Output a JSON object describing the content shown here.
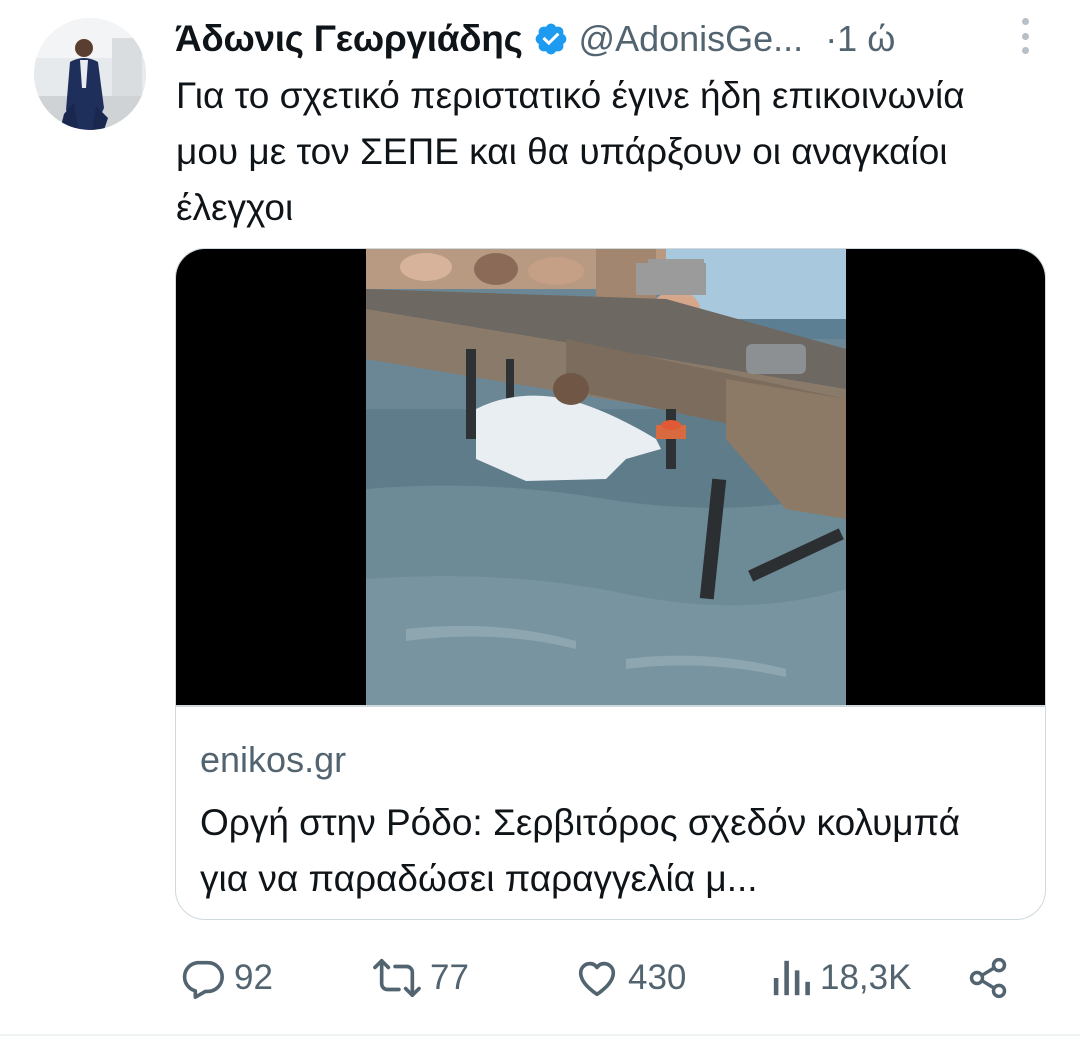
{
  "tweet": {
    "author_name": "Άδωνις Γεωργιάδης",
    "handle": "@AdonisGe...",
    "time": "·1 ώ",
    "text": "Για το σχετικό περιστατικό έγινε ήδη επικοινωνία μου με τον ΣΕΠΕ και θα υπάρξουν οι αναγκαίοι έλεγχοι",
    "verified_icon": "verified-badge-icon",
    "more_icon": "more-vertical-icon"
  },
  "link_card": {
    "domain": "enikos.gr",
    "title": "Οργή στην Ρόδο: Σερβιτόρος σχεδόν κολυμπά για να παραδώσει παραγγελία μ..."
  },
  "actions": {
    "replies": "92",
    "retweets": "77",
    "likes": "430",
    "views": "18,3K"
  },
  "colors": {
    "verified": "#1d9bf0",
    "text_primary": "#0f1419",
    "text_secondary": "#536471",
    "border": "#cfd9de"
  }
}
